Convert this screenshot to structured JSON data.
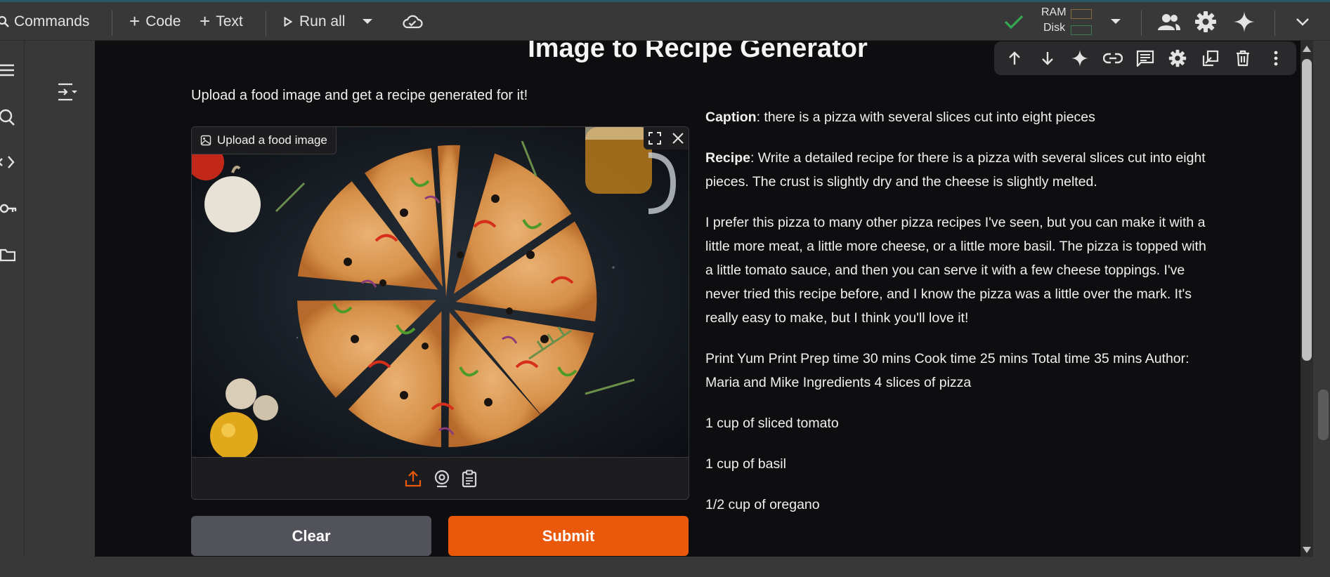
{
  "toolbar": {
    "commands_label": "Commands",
    "code_label": "Code",
    "text_label": "Text",
    "run_all_label": "Run all",
    "ram_label": "RAM",
    "disk_label": "Disk"
  },
  "app": {
    "title": "Image to Recipe Generator",
    "description": "Upload a food image and get a recipe generated for it!",
    "image_input_label": "Upload a food image",
    "clear_label": "Clear",
    "submit_label": "Submit"
  },
  "output": {
    "caption_key": "Caption",
    "caption_text": ": there is a pizza with several slices cut into eight pieces",
    "recipe_key": "Recipe",
    "recipe_text": ": Write a detailed recipe for there is a pizza with several slices cut into eight pieces. The crust is slightly dry and the cheese is slightly melted.",
    "paragraphs": [
      "I prefer this pizza to many other pizza recipes I've seen, but you can make it with a little more meat, a little more cheese, or a little more basil. The pizza is topped with a little tomato sauce, and then you can serve it with a few cheese toppings. I've never tried this recipe before, and I know the pizza was a little over the mark. It's really easy to make, but I think you'll love it!",
      "Print Yum Print Prep time 30 mins Cook time 25 mins Total time 35 mins Author: Maria and Mike Ingredients 4 slices of pizza",
      "1 cup of sliced tomato",
      "1 cup of basil",
      "1/2 cup of oregano"
    ]
  },
  "colors": {
    "accent": "#ea580c",
    "clear_button": "#52525b",
    "cell_background": "#0e0e10",
    "chrome_background": "#383838",
    "status_ok": "#34a853"
  },
  "icons": {
    "left_rail": [
      "table-of-contents-icon",
      "search-icon",
      "code-snippets-icon",
      "key-icon",
      "folder-icon"
    ],
    "cell_toolbar": [
      "move-up-icon",
      "move-down-icon",
      "gemini-icon",
      "link-icon",
      "comment-icon",
      "settings-icon",
      "mirror-cell-icon",
      "delete-icon",
      "more-icon"
    ],
    "image_footer": [
      "upload-icon",
      "webcam-icon",
      "clipboard-icon"
    ]
  }
}
